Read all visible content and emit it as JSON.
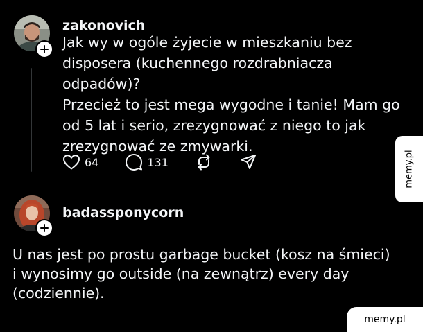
{
  "post": {
    "username": "zakonovich",
    "text_lines": [
      "Jak wy w ogóle żyjecie w mieszkaniu bez",
      "disposera (kuchennego rozdrabniacza",
      "odpadów)?",
      "Przecież to jest mega wygodne i tanie! Mam go",
      "od 5 lat i serio, zrezygnować z niego to jak",
      "zrezygnować ze zmywarki."
    ],
    "likes": "64",
    "comments": "131"
  },
  "reply": {
    "username": "badassponycorn",
    "text_lines": [
      "U nas jest po prostu garbage bucket (kosz na śmieci)",
      "i wynosimy go outside (na zewnątrz) every day",
      "(codziennie)."
    ]
  },
  "icons": {
    "follow": "plus-icon",
    "like": "heart-icon",
    "comment": "comment-icon",
    "repost": "repost-icon",
    "share": "send-icon"
  },
  "colors": {
    "background": "#000000",
    "text": "#f3f5f7",
    "thread_line": "#333638"
  },
  "watermark": {
    "side": "memy.pl",
    "bottom": "memy.pl"
  }
}
